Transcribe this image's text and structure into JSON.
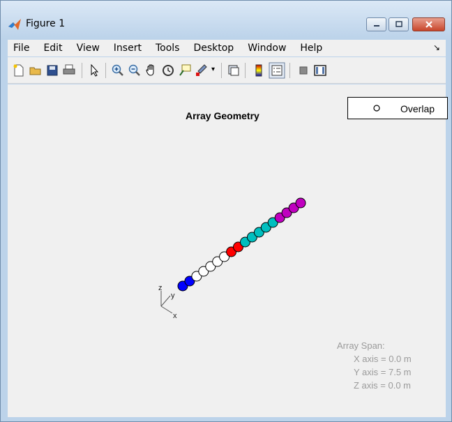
{
  "window": {
    "title": "Figure 1",
    "app_icon": "matlab-logo-icon",
    "buttons": [
      "minimize-icon",
      "maximize-icon",
      "close-icon"
    ]
  },
  "menubar": {
    "items": [
      "File",
      "Edit",
      "View",
      "Insert",
      "Tools",
      "Desktop",
      "Window",
      "Help"
    ]
  },
  "toolbar": {
    "icons": [
      "new-figure-icon",
      "open-file-icon",
      "save-icon",
      "print-icon",
      "pointer-icon",
      "zoom-in-icon",
      "zoom-out-icon",
      "pan-icon",
      "rotate-3d-icon",
      "data-cursor-icon",
      "brush-icon",
      "link-plot-icon",
      "colorbar-icon",
      "legend-icon",
      "hide-plot-tools-icon",
      "show-plot-tools-icon"
    ]
  },
  "axes": {
    "title": "Array Geometry",
    "axis_labels": [
      "z",
      "y",
      "x"
    ]
  },
  "legend": {
    "entry": "Overlap",
    "marker": "circle-marker-icon"
  },
  "array_span": {
    "heading": "Array Span:",
    "x": "X axis = 0.0 m",
    "y": "Y axis = 7.5 m",
    "z": "Z axis = 0.0 m"
  },
  "colors": {
    "blue": "#0000ff",
    "white": "#ffffff",
    "red": "#ff0000",
    "cyan": "#00bfbf",
    "magenta": "#bf00bf"
  },
  "elements": [
    {
      "color": "blue"
    },
    {
      "color": "blue"
    },
    {
      "color": "white"
    },
    {
      "color": "white"
    },
    {
      "color": "white"
    },
    {
      "color": "white"
    },
    {
      "color": "white"
    },
    {
      "color": "red"
    },
    {
      "color": "red"
    },
    {
      "color": "cyan"
    },
    {
      "color": "cyan"
    },
    {
      "color": "cyan"
    },
    {
      "color": "cyan"
    },
    {
      "color": "cyan"
    },
    {
      "color": "magenta"
    },
    {
      "color": "magenta"
    },
    {
      "color": "magenta"
    },
    {
      "color": "magenta"
    }
  ]
}
